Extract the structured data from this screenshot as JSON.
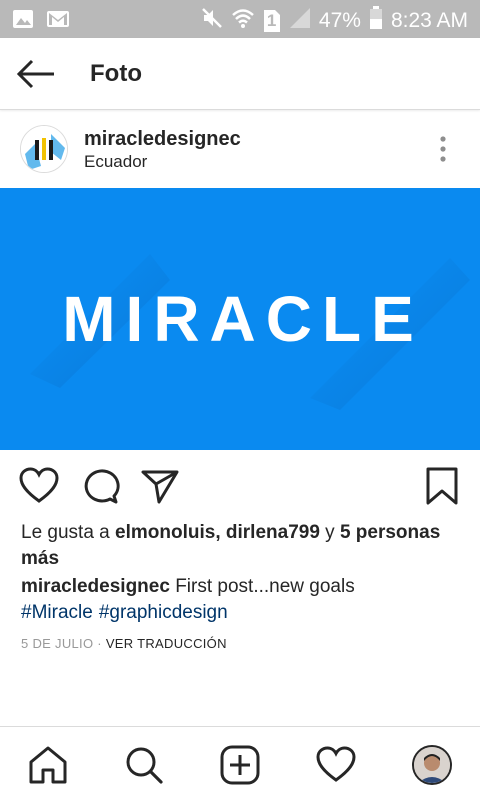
{
  "status_bar": {
    "battery": "47%",
    "time": "8:23 AM",
    "sim_number": "1",
    "icons": [
      "image-icon",
      "gmail-icon",
      "mute-icon",
      "wifi-icon",
      "sim-icon",
      "signal-icon",
      "battery-icon"
    ]
  },
  "app_bar": {
    "title": "Foto",
    "back_icon": "arrow-left-icon"
  },
  "post": {
    "username": "miracledesignec",
    "location": "Ecuador",
    "image_text": "MIRACLE",
    "image_color": "#0a8af0",
    "likes": {
      "prefix": "Le gusta a ",
      "user1": "elmonoluis",
      "sep": ", ",
      "user2": "dirlena799",
      "conj": " y ",
      "others": "5 personas más"
    },
    "caption": {
      "user": "miracledesignec",
      "text": " First post...new goals"
    },
    "hashtags": [
      "#Miracle",
      "#graphicdesign"
    ],
    "date": "5 DE JULIO",
    "dot": " · ",
    "translate": "VER TRADUCCIÓN"
  },
  "actions": [
    "heart-icon",
    "comment-icon",
    "share-icon",
    "bookmark-icon"
  ],
  "bottom_nav": [
    "home-icon",
    "search-icon",
    "add-icon",
    "activity-icon",
    "profile-avatar"
  ],
  "colors": {
    "hashtag": "#003569",
    "status_bar": "#b9b9b9",
    "meta": "#999999"
  }
}
